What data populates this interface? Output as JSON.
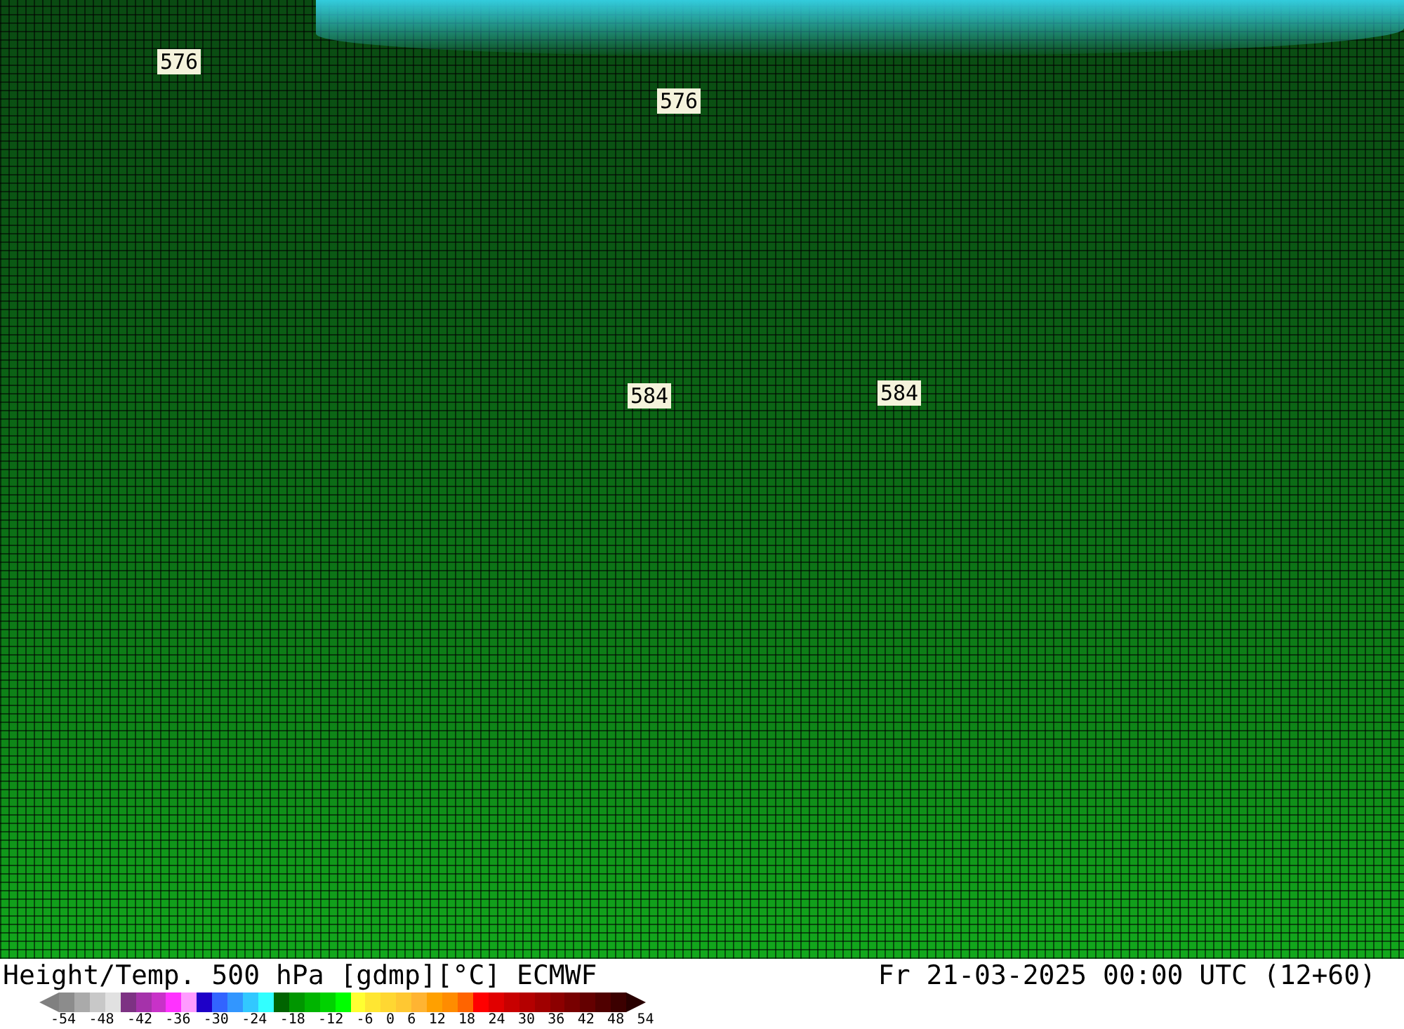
{
  "map": {
    "contour_labels": [
      "576",
      "576",
      "584",
      "584"
    ]
  },
  "title": "Height/Temp. 500 hPa [gdmp][°C] ECMWF",
  "valid_time": "Fr 21-03-2025 00:00 UTC (12+60)",
  "legend": {
    "colors": [
      {
        "color": "#8c8c8c"
      },
      {
        "color": "#aaaaaa"
      },
      {
        "color": "#c8c8c8"
      },
      {
        "color": "#e1e1e1"
      },
      {
        "color": "#7d3283"
      },
      {
        "color": "#a532aa"
      },
      {
        "color": "#c832c8"
      },
      {
        "color": "#ff32ff"
      },
      {
        "color": "#ff9bff"
      },
      {
        "color": "#1e00c8"
      },
      {
        "color": "#3264ff"
      },
      {
        "color": "#3296ff"
      },
      {
        "color": "#32c8ff"
      },
      {
        "color": "#32ffff"
      },
      {
        "color": "#006400"
      },
      {
        "color": "#009600"
      },
      {
        "color": "#00b400"
      },
      {
        "color": "#00d200"
      },
      {
        "color": "#00ff00"
      },
      {
        "color": "#ffff32"
      },
      {
        "color": "#ffe632"
      },
      {
        "color": "#ffd732"
      },
      {
        "color": "#ffc832"
      },
      {
        "color": "#ffb432"
      },
      {
        "color": "#ffa000"
      },
      {
        "color": "#ff8c00"
      },
      {
        "color": "#ff6400"
      },
      {
        "color": "#ff0000"
      },
      {
        "color": "#e10000"
      },
      {
        "color": "#c80000"
      },
      {
        "color": "#b40000"
      },
      {
        "color": "#a00000"
      },
      {
        "color": "#8c0000"
      },
      {
        "color": "#780000"
      },
      {
        "color": "#640000"
      },
      {
        "color": "#500000"
      },
      {
        "color": "#3c0000"
      }
    ],
    "ticks": [
      "-54",
      "-48",
      "-42",
      "-36",
      "-30",
      "-24",
      "-18",
      "-12",
      "-6",
      "0",
      "6",
      "12",
      "18",
      "24",
      "30",
      "36",
      "42",
      "48",
      "54"
    ]
  }
}
